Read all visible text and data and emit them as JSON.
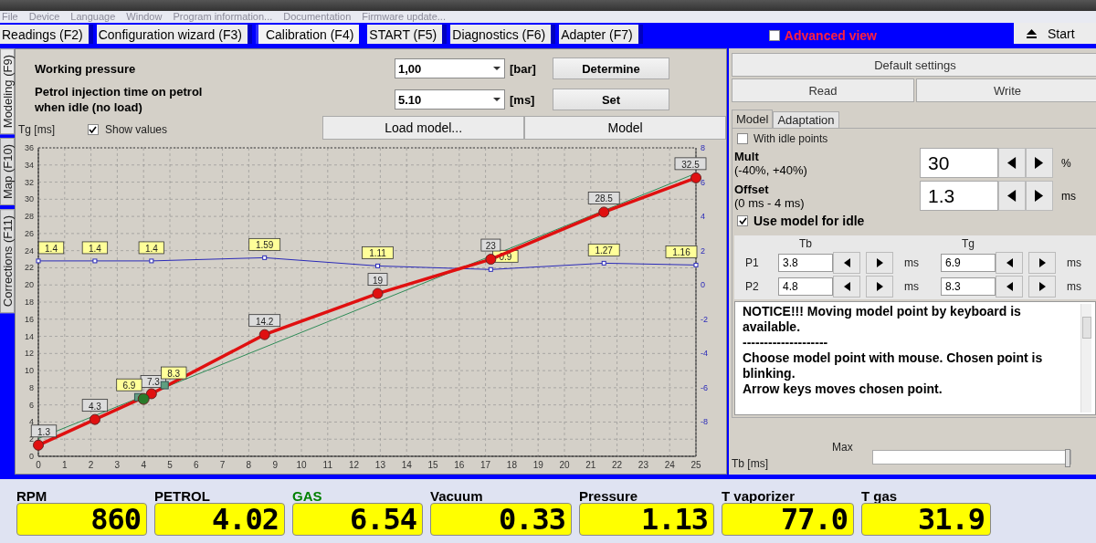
{
  "menu": [
    "File",
    "Device",
    "Language",
    "Window",
    "Program information...",
    "Documentation",
    "Firmware update..."
  ],
  "tabs": [
    {
      "label": "Readings (F2)",
      "selected": false
    },
    {
      "label": "Configuration wizard (F3)",
      "selected": false
    },
    {
      "label": "Calibration (F4)",
      "selected": true
    },
    {
      "label": "START (F5)",
      "selected": false
    },
    {
      "label": "Diagnostics (F6)",
      "selected": false
    },
    {
      "label": "Adapter (F7)",
      "selected": false
    }
  ],
  "advanced_view": {
    "label": "Advanced view",
    "checked": false
  },
  "start_button": {
    "label": "Start"
  },
  "side_tabs": [
    {
      "label": "Modeling (F9)",
      "selected": true
    },
    {
      "label": "Map  (F10)",
      "selected": false
    },
    {
      "label": "Corrections (F11)",
      "selected": false
    }
  ],
  "settings": [
    {
      "label": "Working pressure",
      "value": "1,00",
      "unit": "[bar]",
      "button": "Determine"
    },
    {
      "label": "Petrol injection time on petrol when idle (no load)",
      "value": "5.10",
      "unit": "[ms]",
      "button": "Set"
    }
  ],
  "chart_toolbar": {
    "axis_label": "Tg [ms]",
    "show_values": {
      "label": "Show values",
      "checked": true
    },
    "buttons": [
      "Load model...",
      "Model"
    ]
  },
  "chart_data": {
    "type": "line",
    "xlim": [
      0,
      25
    ],
    "ylim": [
      0,
      36
    ],
    "y2lim": [
      -10,
      8
    ],
    "xticks": [
      0,
      1,
      2,
      3,
      4,
      5,
      6,
      7,
      8,
      9,
      10,
      11,
      12,
      13,
      14,
      15,
      16,
      17,
      18,
      19,
      20,
      21,
      22,
      23,
      24,
      25
    ],
    "yticks": [
      0,
      2,
      4,
      6,
      8,
      10,
      12,
      14,
      16,
      18,
      20,
      22,
      24,
      26,
      28,
      30,
      32,
      34,
      36
    ],
    "y2ticks": [
      -8,
      -6,
      -4,
      -2,
      0,
      2,
      4,
      6,
      8
    ],
    "series": [
      {
        "type": "line",
        "color": "#2a2ab8",
        "marker": "square",
        "axis": "y2",
        "x": [
          0,
          2.15,
          4.3,
          8.6,
          12.9,
          17.2,
          21.5,
          25
        ],
        "values": [
          1.4,
          1.4,
          1.4,
          1.59,
          1.11,
          0.9,
          1.27,
          1.16
        ]
      },
      {
        "type": "line",
        "color": "#e01010",
        "marker": "circle",
        "x": [
          0,
          2.15,
          4.3,
          8.6,
          12.9,
          17.2,
          21.5,
          25
        ],
        "values": [
          1.3,
          4.3,
          7.3,
          14.2,
          19,
          23,
          28.5,
          32.5
        ]
      },
      {
        "type": "scatter",
        "color": "#5f9f80",
        "marker": "square",
        "x": [
          3.8,
          4.8
        ],
        "values": [
          6.9,
          8.3
        ]
      },
      {
        "type": "scatter",
        "color": "#2a7a2a",
        "marker": "circle",
        "data_labels": false,
        "x": [
          4
        ],
        "values": [
          6.7
        ]
      }
    ],
    "grid": true,
    "data_labels": true
  },
  "right_panel": {
    "default_button": "Default settings",
    "buttons": [
      "Read",
      "Write"
    ],
    "subtabs": [
      {
        "label": "Model",
        "selected": true
      },
      {
        "label": "Adaptation",
        "selected": false
      }
    ],
    "with_idle_points": {
      "label": "With idle points",
      "checked": false
    },
    "params": [
      {
        "title": "Mult",
        "range": "(-40%, +40%)",
        "value": "30",
        "unit": "%"
      },
      {
        "title": "Offset",
        "range": "(0 ms - 4 ms)",
        "value": "1.3",
        "unit": "ms"
      }
    ],
    "use_model_for_idle": {
      "label": "Use model for idle",
      "checked": true
    },
    "points_table": {
      "columns": [
        "Tb",
        "Tg"
      ],
      "rows": [
        {
          "label": "P1",
          "cells": [
            {
              "value": "3.8",
              "unit": "ms"
            },
            {
              "value": "6.9",
              "unit": "ms"
            }
          ]
        },
        {
          "label": "P2",
          "cells": [
            {
              "value": "4.8",
              "unit": "ms"
            },
            {
              "value": "8.3",
              "unit": "ms"
            }
          ]
        }
      ]
    },
    "notice": [
      "NOTICE!!! Moving model point by keyboard is available.",
      "--------------------",
      "Choose model point with mouse. Chosen point is blinking.",
      "Arrow keys moves chosen point."
    ],
    "x_axis_label": "Tb [ms]",
    "slider": {
      "label": "Max",
      "level": 1
    }
  },
  "gauges": [
    {
      "label": "RPM",
      "value": "860",
      "color": "#000000"
    },
    {
      "label": "PETROL",
      "value": "4.02",
      "color": "#000000"
    },
    {
      "label": "GAS",
      "value": "6.54",
      "color": "#008000"
    },
    {
      "label": "Vacuum",
      "value": "0.33",
      "color": "#000000"
    },
    {
      "label": "Pressure",
      "value": "1.13",
      "color": "#000000"
    },
    {
      "label": "T vaporizer",
      "value": "77.0",
      "color": "#000000"
    },
    {
      "label": "T gas",
      "value": "31.9",
      "color": "#000000"
    }
  ]
}
